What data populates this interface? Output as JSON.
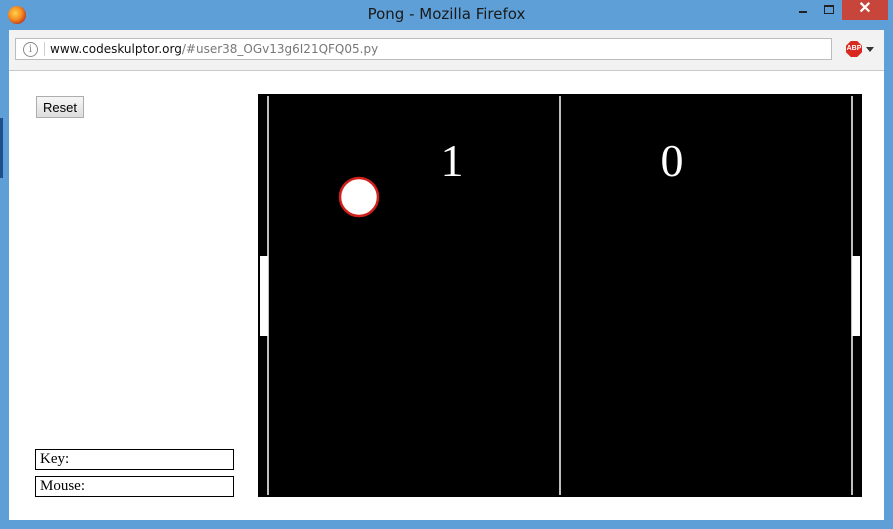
{
  "window": {
    "title": "Pong - Mozilla Firefox",
    "minimize_label": "",
    "maximize_label": "",
    "close_label": "✕"
  },
  "address_bar": {
    "url_domain": "www.codeskulptor.org",
    "url_path": "/#user38_OGv13g6I21QFQ05.py",
    "info_label": "i",
    "adblock_label": "ABP"
  },
  "controls": {
    "reset_label": "Reset",
    "key_label": "Key:",
    "mouse_label": "Mouse:"
  },
  "game": {
    "left_score": "1",
    "right_score": "0",
    "colors": {
      "background": "#000000",
      "lines": "#ffffff",
      "ball_fill": "#ffffff",
      "ball_outline": "#d0201a"
    }
  }
}
